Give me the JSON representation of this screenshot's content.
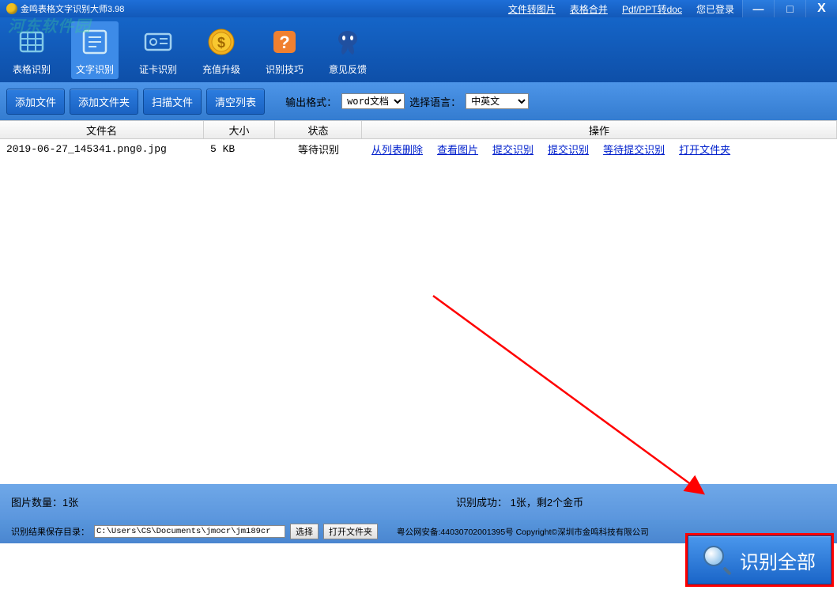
{
  "titlebar": {
    "title": "金鸣表格文字识别大师3.98",
    "links": {
      "file_to_img": "文件转图片",
      "table_merge": "表格合并",
      "pdf_ppt_doc": "Pdf/PPT转doc",
      "logged_in": "您已登录"
    }
  },
  "watermark": "河东软件园",
  "toolbar": {
    "table_ocr": "表格识别",
    "text_ocr": "文字识别",
    "card_ocr": "证卡识别",
    "recharge": "充值升级",
    "tips": "识别技巧",
    "feedback": "意见反馈"
  },
  "actionbar": {
    "add_file": "添加文件",
    "add_folder": "添加文件夹",
    "scan_file": "扫描文件",
    "clear_list": "清空列表",
    "output_format_label": "输出格式：",
    "output_format_value": "word文档",
    "lang_label": "选择语言：",
    "lang_value": "中英文"
  },
  "table": {
    "headers": {
      "name": "文件名",
      "size": "大小",
      "status": "状态",
      "ops": "操作"
    },
    "row": {
      "name": "2019-06-27_145341.png0.jpg",
      "size": "5 KB",
      "status": "等待识别",
      "ops": {
        "remove": "从列表删除",
        "view": "查看图片",
        "submit1": "提交识别",
        "submit2": "提交识别",
        "waiting": "等待提交识别",
        "open_folder": "打开文件夹"
      }
    }
  },
  "status": {
    "image_count": "图片数量：1张",
    "success_info": "识别成功： 1张，剩2个金币"
  },
  "bottom": {
    "save_dir_label": "识别结果保存目录：",
    "path": "C:\\Users\\CS\\Documents\\jmocr\\jm189cr",
    "select_btn": "选择",
    "open_btn": "打开文件夹",
    "copyright": "粤公网安备:44030702001395号 Copyright©深圳市金鸣科技有限公司"
  },
  "big_button": "识别全部"
}
